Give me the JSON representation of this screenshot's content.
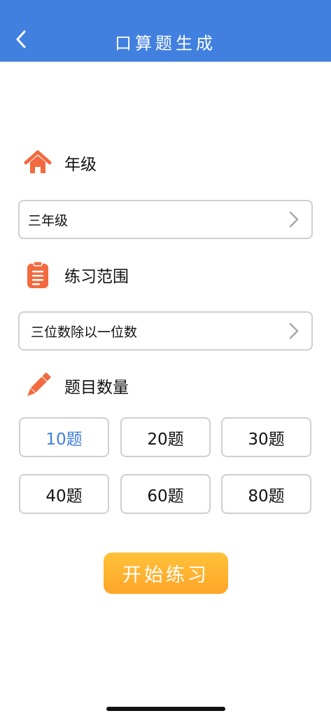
{
  "header": {
    "title": "口算题生成",
    "back_icon": "chevron-left-icon"
  },
  "grade": {
    "title": "年级",
    "icon": "home-icon",
    "selected": "三年级"
  },
  "range": {
    "title": "练习范围",
    "icon": "clipboard-icon",
    "selected": "三位数除以一位数"
  },
  "count": {
    "title": "题目数量",
    "icon": "pencil-icon",
    "options": [
      "10题",
      "20题",
      "30题",
      "40题",
      "60题",
      "80题"
    ],
    "selected": "10题"
  },
  "start_label": "开始练习",
  "colors": {
    "header": "#4180df",
    "icon_orange": "#f26a3f",
    "selected_text": "#3f7fe0",
    "start_button": "#ffae2d"
  }
}
